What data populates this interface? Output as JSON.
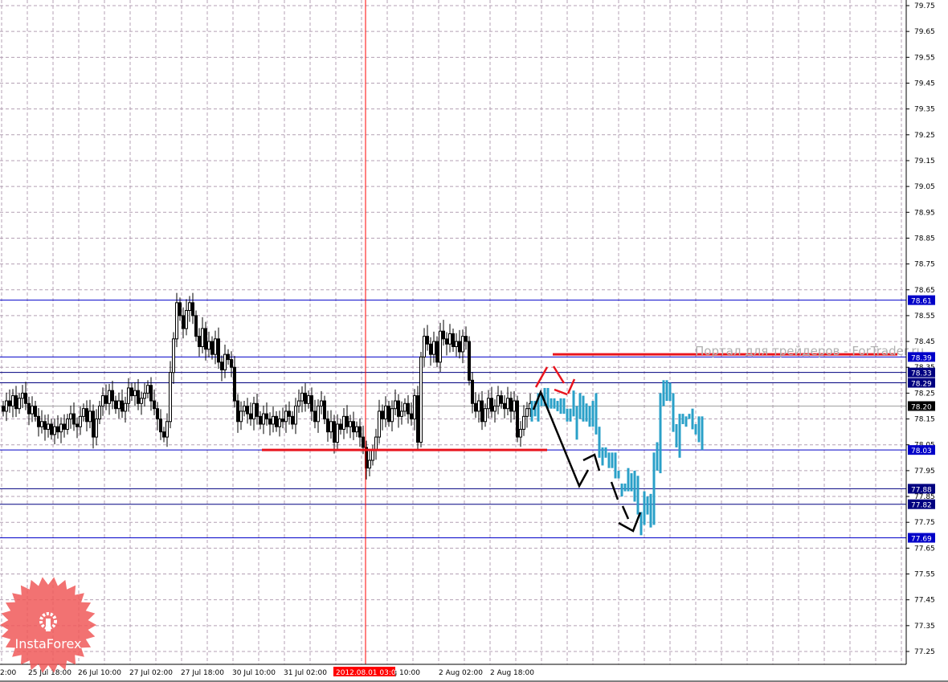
{
  "chart_data": {
    "type": "bar",
    "subtype": "ohlc-candlestick-with-forecast",
    "instrument_period": "1H",
    "title": "",
    "xlabel": "",
    "ylabel": "",
    "ylim": [
      77.2,
      79.77
    ],
    "grid": true,
    "y_ticks": [
      "79.75",
      "79.65",
      "79.55",
      "79.45",
      "79.35",
      "79.25",
      "79.15",
      "79.05",
      "78.95",
      "78.85",
      "78.75",
      "78.65",
      "78.55",
      "78.45",
      "78.35",
      "78.25",
      "78.15",
      "78.05",
      "77.95",
      "77.85",
      "77.75",
      "77.65",
      "77.55",
      "77.45",
      "77.35",
      "77.25"
    ],
    "x_ticks": [
      "2:00",
      "25 Jul 18:00",
      "26 Jul 10:00",
      "27 Jul 02:00",
      "27 Jul 18:00",
      "30 Jul 10:00",
      "31 Jul 02:00",
      "2012.08.01 03:00",
      "1 Aug 10:00",
      "2 Aug 02:00",
      "2 Aug 18:00"
    ],
    "cursor_time_label": "2012.08.01 03:00",
    "closes": [
      78.18,
      78.22,
      78.2,
      78.24,
      78.19,
      78.23,
      78.25,
      78.21,
      78.17,
      78.2,
      78.16,
      78.12,
      78.14,
      78.11,
      78.13,
      78.09,
      78.12,
      78.1,
      78.13,
      78.11,
      78.15,
      78.17,
      78.13,
      78.12,
      78.16,
      78.19,
      78.14,
      78.18,
      78.08,
      78.15,
      78.2,
      78.24,
      78.21,
      78.26,
      78.22,
      78.19,
      78.22,
      78.18,
      78.21,
      78.27,
      78.24,
      78.26,
      78.21,
      78.23,
      78.25,
      78.28,
      78.22,
      78.19,
      78.15,
      78.1,
      78.08,
      78.14,
      78.33,
      78.46,
      78.6,
      78.55,
      78.5,
      78.57,
      78.6,
      78.55,
      78.47,
      78.43,
      78.5,
      78.42,
      78.45,
      78.4,
      78.46,
      78.37,
      78.34,
      78.4,
      78.38,
      78.35,
      78.22,
      78.14,
      78.18,
      78.2,
      78.17,
      78.15,
      78.21,
      78.16,
      78.13,
      78.17,
      78.15,
      78.13,
      78.16,
      78.12,
      78.15,
      78.14,
      78.18,
      78.16,
      78.13,
      78.2,
      78.22,
      78.25,
      78.21,
      78.24,
      78.18,
      78.14,
      78.2,
      78.22,
      78.15,
      78.1,
      78.14,
      78.06,
      78.13,
      78.11,
      78.16,
      78.12,
      78.14,
      78.1,
      78.12,
      78.08,
      78.04,
      77.96,
      77.99,
      78.03,
      78.08,
      78.18,
      78.15,
      78.2,
      78.14,
      78.19,
      78.22,
      78.16,
      78.18,
      78.21,
      78.17,
      78.15,
      78.24,
      78.06,
      78.39,
      78.47,
      78.44,
      78.4,
      78.45,
      78.37,
      78.49,
      78.46,
      78.44,
      78.48,
      78.43,
      78.45,
      78.41,
      78.47,
      78.45,
      78.3,
      78.21,
      78.18,
      78.22,
      78.14,
      78.19,
      78.23,
      78.18,
      78.2,
      78.24,
      78.21,
      78.19,
      78.23,
      78.18,
      78.22,
      78.08,
      78.11,
      78.16,
      78.19,
      78.21
    ],
    "forecast_bars_high_low": [
      [
        78.22,
        78.14
      ],
      [
        78.22,
        78.16
      ],
      [
        78.25,
        78.14
      ],
      [
        78.25,
        78.2
      ],
      [
        78.27,
        78.2
      ],
      [
        78.27,
        78.19
      ],
      [
        78.23,
        78.19
      ],
      [
        78.23,
        78.19
      ],
      [
        78.22,
        78.18
      ],
      [
        78.23,
        78.17
      ],
      [
        78.23,
        78.17
      ],
      [
        78.19,
        78.14
      ],
      [
        78.19,
        78.14
      ],
      [
        78.26,
        78.16
      ],
      [
        78.2,
        78.07
      ],
      [
        78.25,
        78.15
      ],
      [
        78.24,
        78.14
      ],
      [
        78.21,
        78.14
      ],
      [
        78.2,
        78.12
      ],
      [
        78.22,
        78.12
      ],
      [
        78.25,
        78.09
      ],
      [
        78.12,
        78.0
      ],
      [
        78.04,
        77.97
      ],
      [
        78.04,
        78.0
      ],
      [
        78.02,
        77.96
      ],
      [
        78.02,
        77.96
      ],
      [
        78.02,
        77.92
      ],
      [
        77.95,
        77.92
      ],
      [
        77.9,
        77.85
      ],
      [
        77.9,
        77.87
      ],
      [
        77.96,
        77.87
      ],
      [
        77.94,
        77.87
      ],
      [
        77.95,
        77.83
      ],
      [
        77.93,
        77.78
      ],
      [
        77.79,
        77.7
      ],
      [
        77.87,
        77.74
      ],
      [
        77.85,
        77.78
      ],
      [
        77.86,
        77.73
      ],
      [
        78.02,
        77.74
      ],
      [
        78.06,
        77.95
      ],
      [
        78.25,
        77.94
      ],
      [
        78.3,
        78.2
      ],
      [
        78.3,
        78.22
      ],
      [
        78.29,
        78.22
      ],
      [
        78.25,
        78.1
      ],
      [
        78.13,
        78.04
      ],
      [
        78.17,
        78.0
      ],
      [
        78.17,
        78.13
      ],
      [
        78.16,
        78.12
      ],
      [
        78.17,
        78.15
      ],
      [
        78.19,
        78.11
      ],
      [
        78.13,
        78.09
      ],
      [
        78.16,
        78.06
      ],
      [
        78.16,
        78.03
      ]
    ],
    "levels": [
      {
        "price": "78.61",
        "color": "#0000c8"
      },
      {
        "price": "78.39",
        "color": "#0000c8"
      },
      {
        "price": "78.33",
        "color": "#000080"
      },
      {
        "price": "78.29",
        "color": "#000080"
      },
      {
        "price": "78.03",
        "color": "#0000c8"
      },
      {
        "price": "77.88",
        "color": "#000080"
      },
      {
        "price": "77.82",
        "color": "#000080"
      },
      {
        "price": "77.69",
        "color": "#0000c8"
      }
    ],
    "bid_level": {
      "price": "78.20",
      "color": "#000000"
    },
    "red_resistance": 78.4,
    "red_support": 78.03,
    "colors": {
      "forecast": "#2aa0c8",
      "annotation_red": "#e8141e",
      "cursor": "#ff0000",
      "grid": "#b4a0b4"
    }
  },
  "watermark": "Портал для трейдеров - ForTrader.ru",
  "logo": {
    "text": "InstaForex",
    "color": "#f05a5a"
  }
}
